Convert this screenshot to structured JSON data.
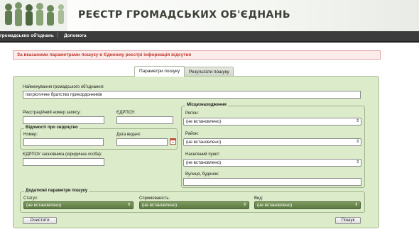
{
  "header": {
    "title": "РЕЄСТР ГРОМАДСЬКИХ ОБ'ЄДНАНЬ"
  },
  "nav": {
    "items": [
      "громадських об'єднань",
      "Допомога"
    ]
  },
  "alert": {
    "text": "За вказаними параметрами пошуку в Єдиному реєстрі інформація відсутня"
  },
  "tabs": [
    {
      "label": "Параметри пошуку",
      "active": true
    },
    {
      "label": "Результати пошуку",
      "active": false
    }
  ],
  "form": {
    "name": {
      "label": "Найменування громадського об'єднання:",
      "value": "патріотичне братство прикордонників"
    },
    "reg_number": {
      "label": "Реєстраційний номер запису:",
      "value": ""
    },
    "edrpou": {
      "label": "ЄДРПОУ:",
      "value": ""
    },
    "certificate": {
      "legend": "Відомості про свідоцтво",
      "number": {
        "label": "Номер:",
        "value": ""
      },
      "issue_date": {
        "label": "Дата видачі:",
        "value": ""
      }
    },
    "founder_edrpou": {
      "label": "ЄДРПОУ засновника (юридична особа):",
      "value": ""
    },
    "location": {
      "legend": "Місцезнаходження",
      "region": {
        "label": "Регіон:",
        "value": "(не встановлено)"
      },
      "district": {
        "label": "Район:",
        "value": "(не встановлено)"
      },
      "settlement": {
        "label": "Населений пункт:",
        "value": "(не встановлено)"
      },
      "street": {
        "label": "Вулиця, будинок:",
        "value": ""
      }
    },
    "extra": {
      "legend": "Додаткові параметри пошуку",
      "status": {
        "label": "Статус:",
        "value": "(не встановлено)"
      },
      "affiliation": {
        "label": "Спрямованість:",
        "value": "(не встановлено)"
      },
      "kind": {
        "label": "Вид:",
        "value": "(не встановлено)"
      }
    }
  },
  "buttons": {
    "clear": "Очистити",
    "search": "Пошук"
  },
  "colors": {
    "panel": "#dcebc9",
    "alert_text": "#c0392b",
    "nav": "#3c3c3c",
    "green_select": "#5c7a42"
  }
}
